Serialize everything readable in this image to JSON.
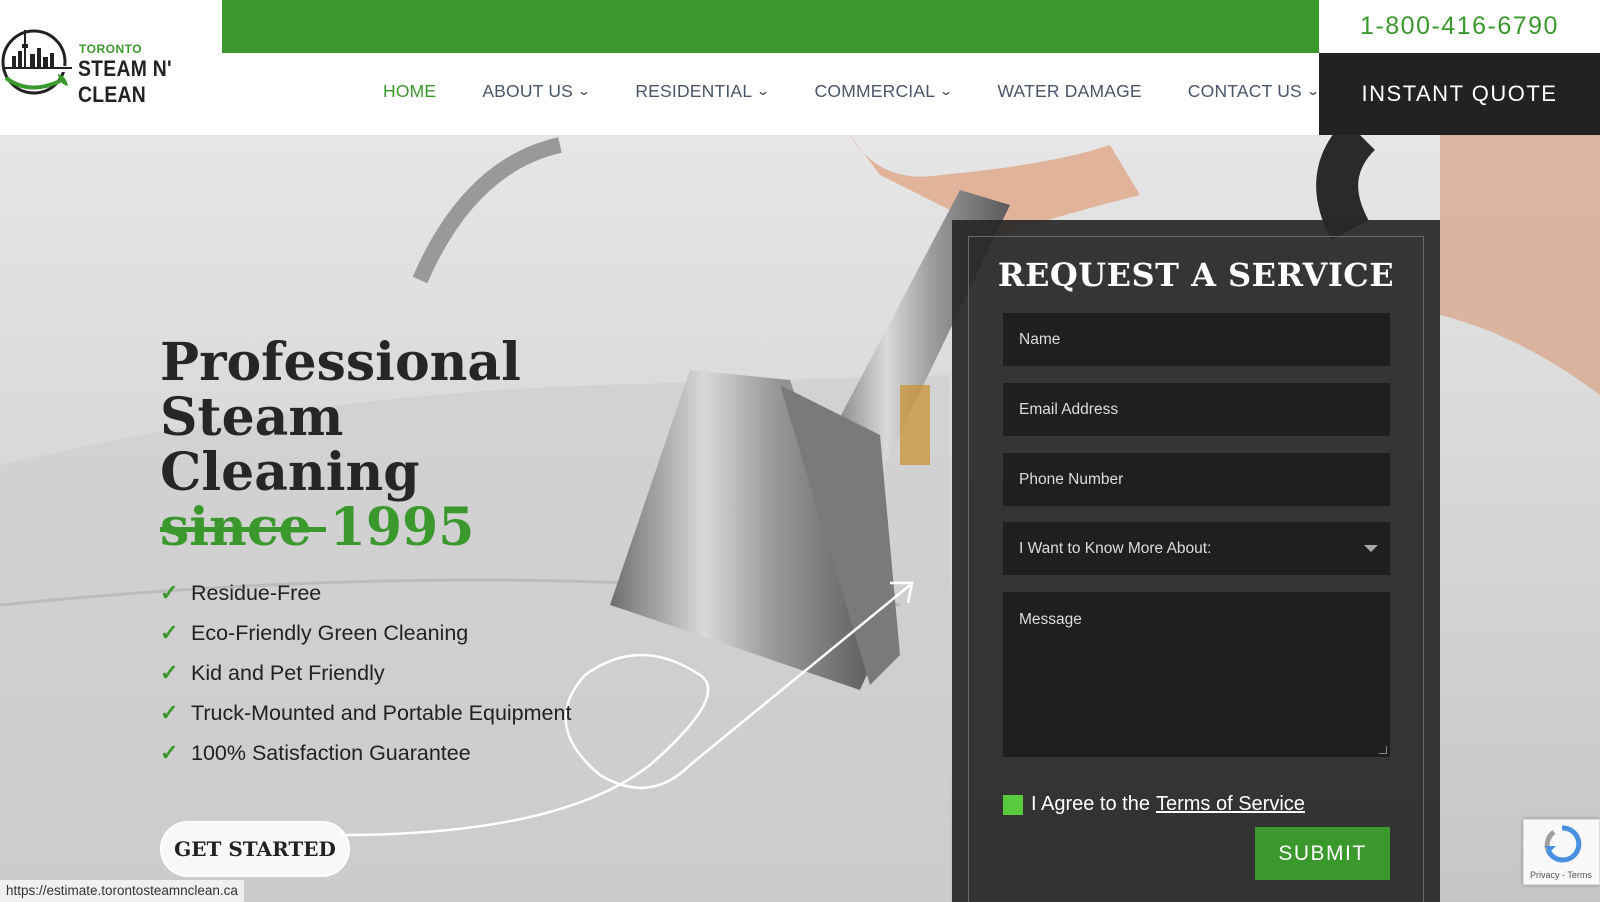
{
  "header": {
    "logo": {
      "small": "TORONTO",
      "big": "STEAM N' CLEAN"
    },
    "phone": "1-800-416-6790",
    "quote_label": "INSTANT QUOTE",
    "colors": {
      "brand_green": "#3a982d",
      "dark": "#222222"
    }
  },
  "nav": {
    "items": [
      {
        "label": "HOME",
        "active": true,
        "dropdown": false
      },
      {
        "label": "ABOUT US",
        "active": false,
        "dropdown": true
      },
      {
        "label": "RESIDENTIAL",
        "active": false,
        "dropdown": true
      },
      {
        "label": "COMMERCIAL",
        "active": false,
        "dropdown": true
      },
      {
        "label": "WATER DAMAGE",
        "active": false,
        "dropdown": false
      },
      {
        "label": "CONTACT US",
        "active": false,
        "dropdown": true
      }
    ],
    "chevron_icon": "chevron-down-icon"
  },
  "hero": {
    "headline_line1": "Professional Steam",
    "headline_line2": "Cleaning",
    "headline_green": "since 1995",
    "features": [
      "Residue-Free",
      "Eco-Friendly Green Cleaning",
      "Kid and Pet Friendly",
      "Truck-Mounted and Portable Equipment",
      "100% Satisfaction Guarantee"
    ],
    "check_icon": "check-icon",
    "cta": "GET STARTED"
  },
  "form": {
    "title": "REQUEST A SERVICE",
    "name_placeholder": "Name",
    "email_placeholder": "Email Address",
    "phone_placeholder": "Phone Number",
    "select_placeholder": "I Want to Know More About:",
    "message_placeholder": "Message",
    "agree_text": "I Agree to the",
    "terms_link": "Terms of Service",
    "submit_label": "SUBMIT"
  },
  "recaptcha": {
    "text": "Privacy - Terms"
  },
  "status_bar": {
    "url": "https://estimate.torontosteamnclean.ca"
  }
}
